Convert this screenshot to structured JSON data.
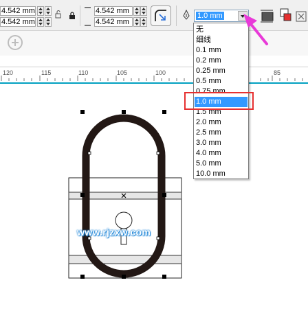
{
  "toolbar": {
    "width_field_1": "4.542 mm",
    "width_field_2": "4.542 mm",
    "height_field_1": "4.542 mm",
    "height_field_2": "4.542 mm",
    "outline_width_value": "1.0 mm"
  },
  "ruler": {
    "labels": [
      "120",
      "115",
      "110",
      "105",
      "100",
      "85"
    ]
  },
  "outline_dropdown": {
    "options": [
      "无",
      "细线",
      "0.1 mm",
      "0.2 mm",
      "0.25 mm",
      "0.5 mm",
      "0.75 mm",
      "1.0 mm",
      "1.5 mm",
      "2.0 mm",
      "2.5 mm",
      "3.0 mm",
      "4.0 mm",
      "5.0 mm",
      "10.0 mm"
    ],
    "selected": "1.0 mm"
  },
  "watermark": "www.rjzxw.com",
  "colors": {
    "selection": "#3399ff",
    "highlight": "#e63030",
    "arrow": "#e83ad8",
    "ruler_accent": "#00a0c0"
  }
}
